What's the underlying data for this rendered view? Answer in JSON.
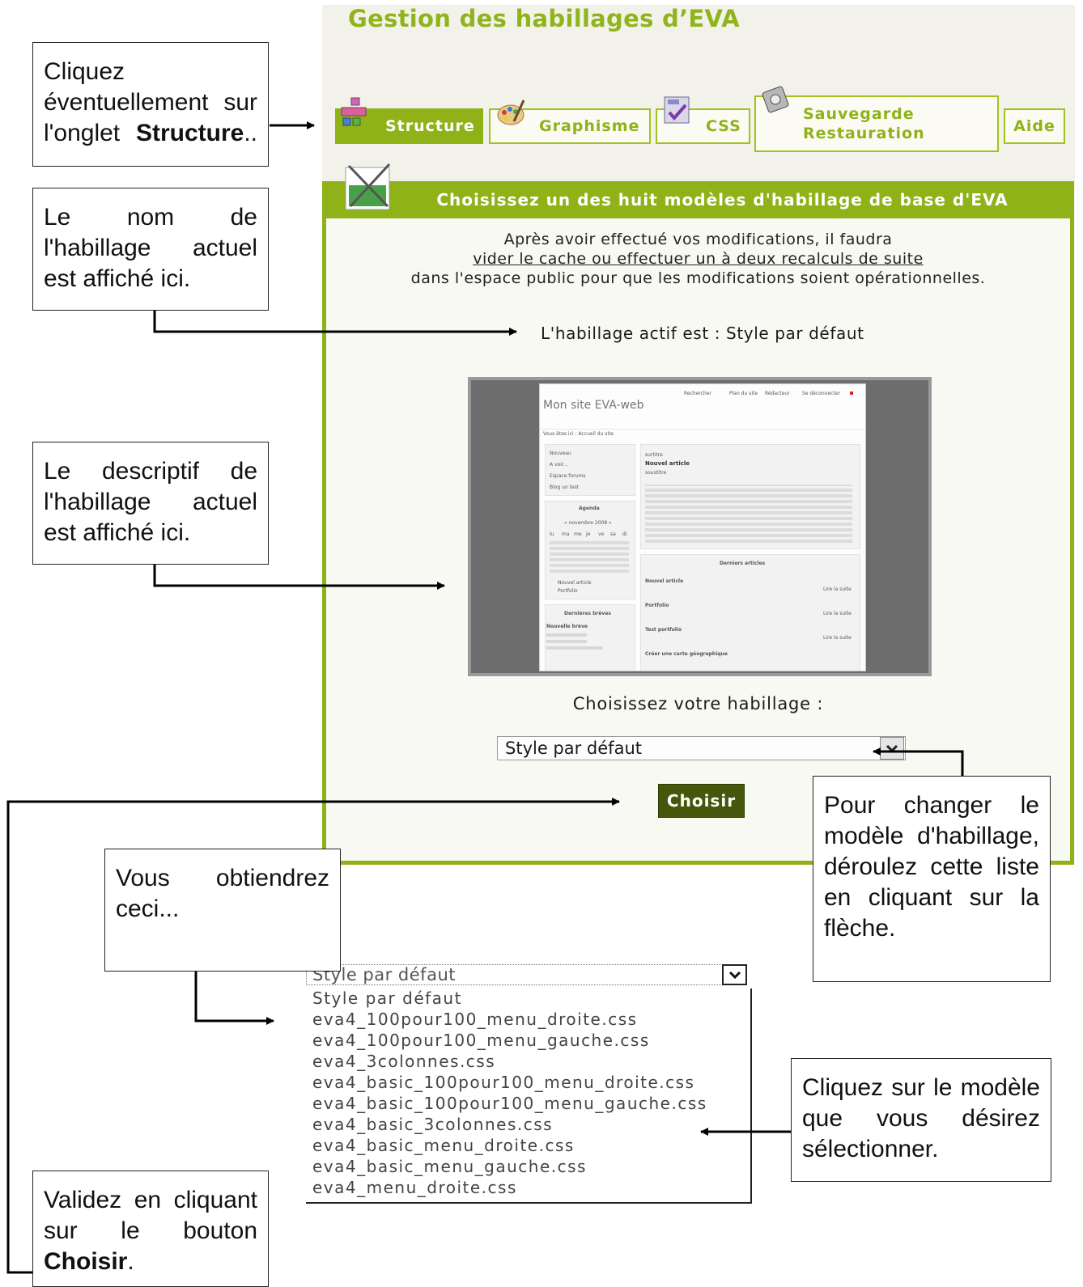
{
  "app": {
    "title": "Gestion des habillages d’EVA",
    "tabs": [
      {
        "label": "Structure",
        "active": true
      },
      {
        "label": "Graphisme",
        "active": false
      },
      {
        "label": "CSS",
        "active": false
      },
      {
        "label_line1": "Sauvegarde",
        "label_line2": "Restauration",
        "active": false
      },
      {
        "label": "Aide",
        "active": false
      }
    ],
    "panel_heading": "Choisissez un des huit modèles d'habillage de base d'EVA",
    "notice": {
      "line1": "Après avoir effectué vos modifications, il faudra",
      "link": "vider le cache ou effectuer un à deux recalculs de suite",
      "line3": "dans l'espace public pour que les modifications soient opérationnelles."
    },
    "active_skin_text": "L'habillage actif est : Style par défaut",
    "preview": {
      "site_title": "Mon site EVA-web",
      "top_links": [
        "Rechercher",
        "Plan du site",
        "Rédacteur",
        "Se déconnecter"
      ],
      "breadcrumb": "Vous êtes ici : Accueil du site",
      "menu_items": [
        "Nouveau",
        "A voir...",
        "Espace forums",
        "Blog un test"
      ],
      "agenda_title": "Agenda",
      "agenda_month": "« novembre 2008 »",
      "agenda_days": [
        "lu",
        "ma",
        "me",
        "je",
        "ve",
        "sa",
        "di"
      ],
      "agenda_entries": [
        "Nouvel article",
        "Portfolio"
      ],
      "breves_title": "Dernières brèves",
      "breve_item": "Nouvelle brève",
      "article_surtitle": "surtitre",
      "article_title": "Nouvel article",
      "article_soustitre": "soustitre",
      "derniers_title": "Derniers articles",
      "derniers_items": [
        "Nouvel article",
        "Portfolio",
        "Test portfolio",
        "Créer une carte géographique"
      ],
      "lire_suite": "Lire la suite"
    },
    "choose_label": "Choisissez votre habillage :",
    "select_value": "Style par défaut",
    "choose_button": "Choisir",
    "colors": {
      "accent": "#8fb219",
      "button": "#46560a",
      "background": "#f3f2ea"
    }
  },
  "dropdown": {
    "selected": "Style par défaut",
    "options": [
      "Style par défaut",
      "eva4_100pour100_menu_droite.css",
      "eva4_100pour100_menu_gauche.css",
      "eva4_3colonnes.css",
      "eva4_basic_100pour100_menu_droite.css",
      "eva4_basic_100pour100_menu_gauche.css",
      "eva4_basic_3colonnes.css",
      "eva4_basic_menu_droite.css",
      "eva4_basic_menu_gauche.css",
      "eva4_menu_droite.css"
    ]
  },
  "callouts": {
    "structure": {
      "pre": "Cliquez éventuellement sur l'onglet ",
      "bold": "Structure",
      "post": ".."
    },
    "name": "Le nom de l'habillage actuel est affiché ici.",
    "descriptif": "Le descriptif de l'habillage actuel est affiché ici.",
    "change": "Pour changer le modèle d'habillage, déroulez cette liste en cliquant sur la flèche.",
    "obtain": "Vous obtiendrez ceci...",
    "select_model": "Cliquez sur le modèle que vous désirez sélectionner.",
    "validate": {
      "pre": "Validez en cliquant sur le bouton ",
      "bold": "Choisir",
      "post": "."
    }
  }
}
